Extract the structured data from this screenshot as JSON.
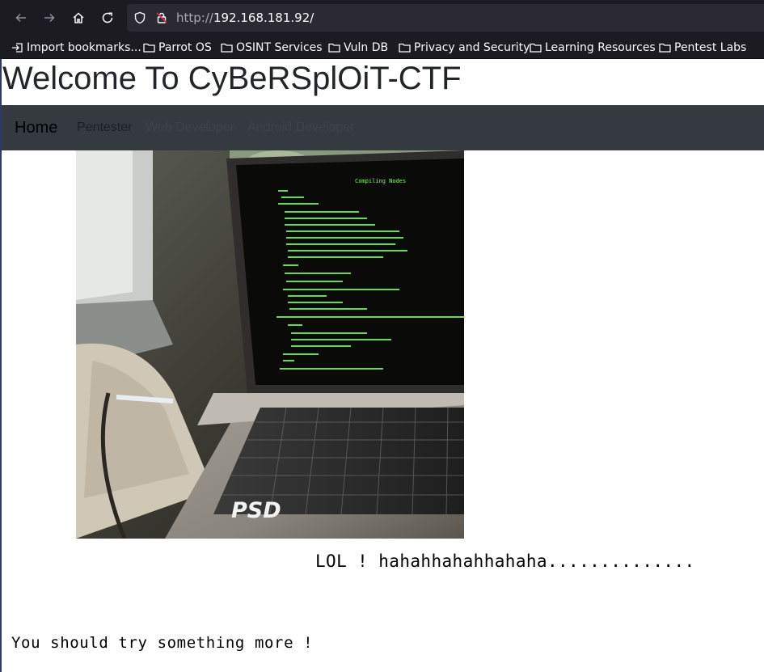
{
  "browser": {
    "url_protocol": "http://",
    "url_host": "192.168.181.92/",
    "bookmarks": [
      {
        "label": "Import bookmarks...",
        "icon": "import-icon"
      },
      {
        "label": "Parrot OS",
        "icon": "folder-icon"
      },
      {
        "label": "OSINT Services",
        "icon": "folder-icon"
      },
      {
        "label": "Vuln DB",
        "icon": "folder-icon"
      },
      {
        "label": "Privacy and Security",
        "icon": "folder-icon"
      },
      {
        "label": "Learning Resources",
        "icon": "folder-icon"
      },
      {
        "label": "Pentest Labs",
        "icon": "folder-icon"
      }
    ]
  },
  "page": {
    "title": "Welcome To CyBeRSplOiT-CTF",
    "nav": {
      "brand": "Home",
      "links": [
        "Pentester",
        "Web Developer",
        "Android Developer"
      ]
    },
    "image_watermark": "PSD",
    "laptop_screen_heading": "Compiling Nodes",
    "lol_text": "LOL ! hahahhahahhahaha..............",
    "try_text": "You should try something more !"
  },
  "colors": {
    "chrome_bg": "#1c1b22",
    "urlbar_bg": "#2b2a33",
    "navbar_bg": "#343a40",
    "terminal_green": "#7dff5a"
  }
}
